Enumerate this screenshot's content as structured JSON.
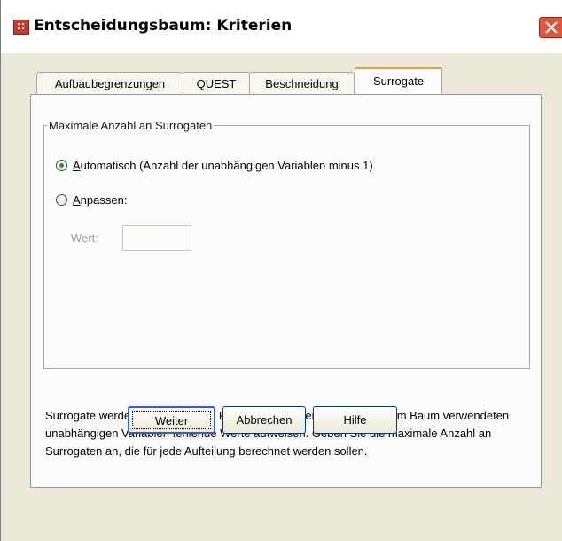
{
  "window": {
    "title": "Entscheidungsbaum: Kriterien"
  },
  "tabs": [
    {
      "label": "Aufbaubegrenzungen",
      "active": false
    },
    {
      "label": "QUEST",
      "active": false
    },
    {
      "label": "Beschneidung",
      "active": false
    },
    {
      "label": "Surrogate",
      "active": true
    }
  ],
  "group": {
    "legend": "Maximale Anzahl an Surrogaten",
    "options": [
      {
        "mnemonic": "A",
        "rest": "utomatisch (Anzahl der unabhängigen Variablen minus 1)",
        "checked": true
      },
      {
        "mnemonic": "A",
        "rest": "npassen:",
        "checked": false
      }
    ],
    "wert_label": "Wert:",
    "wert_value": ""
  },
  "description": "Surrogate werden verwendet, um Fälle zu klassifizieren, die bei den im Baum verwendeten unabhängigen Variablen fehlende Werte aufweisen. Geben Sie die maximale Anzahl an Surrogaten an, die für jede Aufteilung berechnet werden sollen.",
  "buttons": {
    "weiter": "Weiter",
    "abbrechen": "Abbrechen",
    "hilfe": "Hilfe"
  },
  "colors": {
    "dialog_bg": "#ece9d8",
    "tab_accent": "#f0a030",
    "radio_dot": "#21a121",
    "close_button": "#e0563a"
  }
}
